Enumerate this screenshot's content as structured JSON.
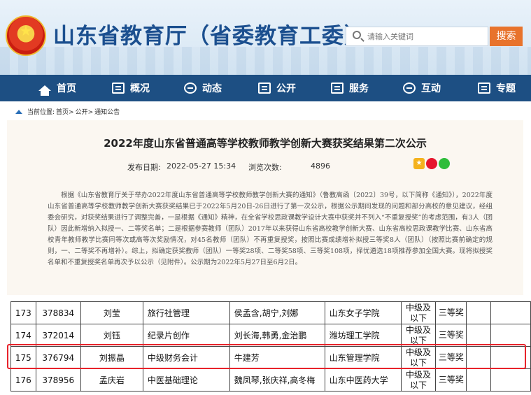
{
  "header": {
    "site_title": "山东省教育厅（省委教育工委）",
    "search_placeholder": "请输入关键词",
    "search_button": "搜索"
  },
  "nav": [
    {
      "label": "首页",
      "icon": "home-icon"
    },
    {
      "label": "概况",
      "icon": "overview-icon"
    },
    {
      "label": "动态",
      "icon": "news-icon"
    },
    {
      "label": "公开",
      "icon": "book-icon"
    },
    {
      "label": "服务",
      "icon": "service-icon"
    },
    {
      "label": "互动",
      "icon": "chat-icon"
    },
    {
      "label": "专题",
      "icon": "topic-icon"
    }
  ],
  "breadcrumb": {
    "prefix": "当前位置:",
    "items": [
      "首页>",
      "公开>",
      "通知公告"
    ]
  },
  "article": {
    "title": "2022年度山东省普通高等学校教师教学创新大赛获奖结果第二次公示",
    "publish_label": "发布日期:",
    "publish_date": "2022-05-27 15:34",
    "views_label": "浏览次数:",
    "views": "4896",
    "body": "根据《山东省教育厅关于举办2022年度山东省普通高等学校教师教学创新大赛的通知》（鲁教高函〔2022〕39号，以下简称《通知》），2022年度山东省普通高等学校教师教学创新大赛获奖结果已于2022年5月20日-26日进行了第一次公示，根据公示期间发现的问题和部分高校的意见建议，经组委会研究，对获奖结果进行了调整完善，一是根据《通知》精神，在全省学校思政课教学设计大赛中获奖并不列入“不重复授奖”的考虑范围，有3人（团队）因此新增纳入拟授一、二等奖名单；二是根据参赛教师（团队）2017年以来获得山东省高校教学创新大赛、山东省高校思政课教学比赛、山东省高校青年教师教学比赛同等次或高等次奖励情况，对45名教师（团队）不再重复授奖，按照比赛成绩增补拟授三等奖8人（团队）（按照比赛前确定的规则，一、二等奖不再增补）。综上，拟确定获奖教师（团队）一等奖28项、二等奖58项、三等奖108项，择优遴选18项推荐参加全国大赛。现将拟授奖名单和不重复授奖名单再次予以公示（见附件）。公示期为2022年5月27日至6月2日。"
  },
  "table": {
    "rows": [
      [
        "173",
        "378834",
        "刘莹",
        "旅行社管理",
        "侯孟含,胡宁,刘娜",
        "山东女子学院",
        "中级及以下",
        "三等奖",
        "",
        ""
      ],
      [
        "174",
        "372014",
        "刘钰",
        "纪录片创作",
        "刘长海,韩勇,金治鹏",
        "潍坊理工学院",
        "中级及以下",
        "三等奖",
        "",
        ""
      ],
      [
        "175",
        "376794",
        "刘振晶",
        "中级财务会计",
        "牛建芳",
        "山东管理学院",
        "中级及以下",
        "三等奖",
        "",
        ""
      ],
      [
        "176",
        "378956",
        "孟庆岩",
        "中医基础理论",
        "魏凤琴,张庆祥,高冬梅",
        "山东中医药大学",
        "中级及以下",
        "三等奖",
        "",
        ""
      ]
    ]
  },
  "colors": {
    "nav_bg": "#1d4f83",
    "title_blue": "#1b4f8f",
    "search_orange": "#e8732c",
    "highlight_red": "#e8232b"
  }
}
